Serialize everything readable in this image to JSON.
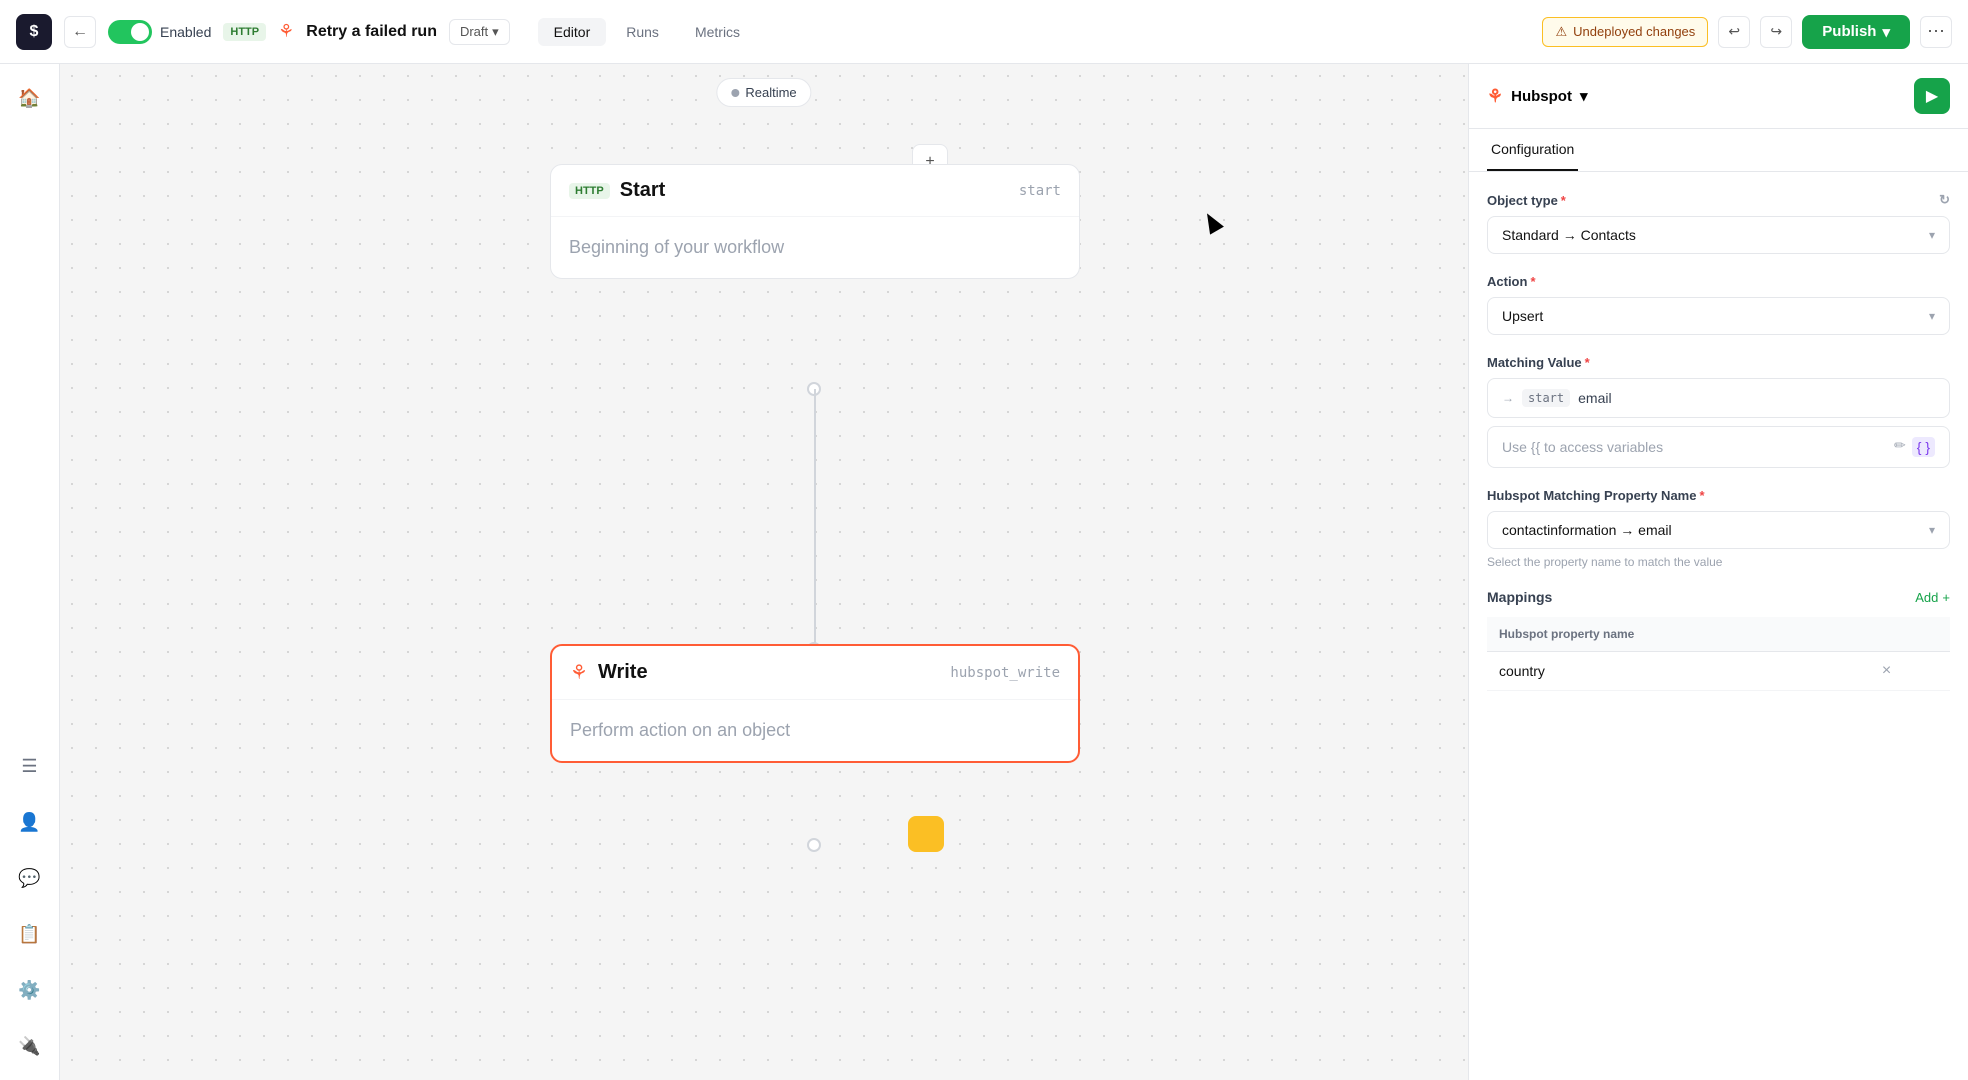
{
  "app": {
    "logo": "$",
    "toggle_state": "Enabled",
    "http_badge": "HTTP",
    "workflow_title": "Retry a failed run",
    "draft_label": "Draft",
    "nav": {
      "tabs": [
        "Editor",
        "Runs",
        "Metrics"
      ],
      "active": "Editor"
    },
    "undeployed_label": "Undeployed changes",
    "publish_label": "Publish",
    "undo_icon": "↩",
    "redo_icon": "↪"
  },
  "sidebar": {
    "icons": [
      "🏠",
      "☰",
      "👤",
      "💬",
      "📋",
      "⚙️",
      "🔌"
    ]
  },
  "canvas": {
    "realtime_label": "Realtime",
    "start_node": {
      "badge": "HTTP",
      "title": "Start",
      "id": "start",
      "body": "Beginning of your workflow"
    },
    "write_node": {
      "title": "Write",
      "id": "hubspot_write",
      "body": "Perform action on an object"
    }
  },
  "right_panel": {
    "integration": "Hubspot",
    "tabs": [
      "Configuration"
    ],
    "active_tab": "Configuration",
    "object_type_label": "Object type",
    "object_type_value": "Standard → Contacts",
    "action_label": "Action",
    "action_value": "Upsert",
    "matching_value_label": "Matching Value",
    "matching_value_arrow": "→",
    "matching_value_badge": "start",
    "matching_value_text": "email",
    "variable_placeholder": "Use {{ to access variables",
    "hubspot_matching_label": "Hubspot Matching Property Name",
    "hubspot_matching_value": "contactinformation → email",
    "hubspot_matching_hint": "Select the property name to match the value",
    "mappings_label": "Mappings",
    "add_label": "Add",
    "mappings_columns": [
      "Hubspot property name"
    ],
    "mappings_rows": [
      {
        "property": "country"
      }
    ]
  }
}
